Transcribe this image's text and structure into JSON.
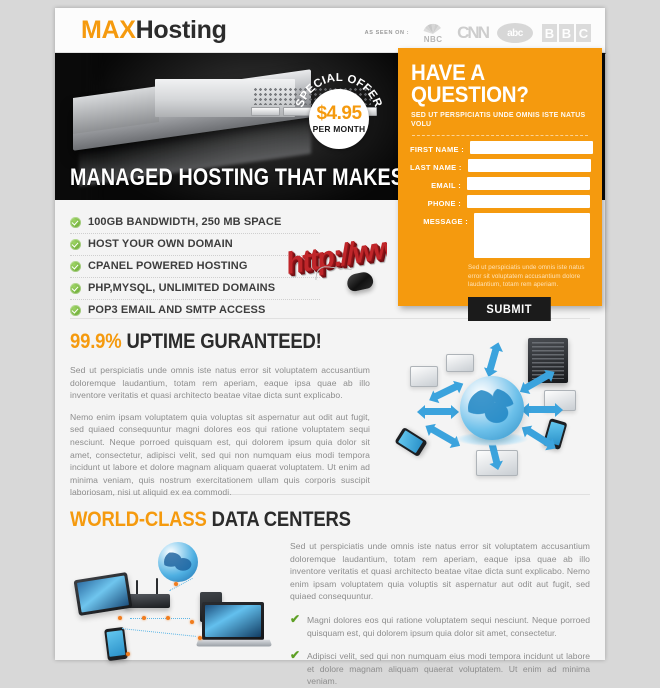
{
  "header": {
    "logo_primary": "MAX",
    "logo_secondary": "Hosting",
    "as_seen_label": "AS SEEN ON :",
    "brands": [
      "NBC",
      "CNN",
      "abc",
      "BBC"
    ],
    "nbc_label": "NBC",
    "cnn_label": "CNN",
    "abc_label": "abc",
    "bbc_letters": [
      "B",
      "B",
      "C"
    ]
  },
  "hero": {
    "headline": "MANAGED HOSTING THAT MAKES SENSE",
    "offer_ring": "SPECIAL OFFER",
    "offer_price": "$4.95",
    "offer_period": "PER MONTH",
    "server_image_alt": "rackmount-server"
  },
  "form": {
    "title": "HAVE A QUESTION?",
    "subtitle": "SED UT PERSPICIATIS UNDE OMNIS ISTE NATUS VOLU",
    "fields": [
      {
        "label": "FIRST NAME :",
        "value": "",
        "placeholder": ""
      },
      {
        "label": "LAST NAME :",
        "value": "",
        "placeholder": ""
      },
      {
        "label": "EMAIL :",
        "value": "",
        "placeholder": ""
      },
      {
        "label": "PHONE :",
        "value": "",
        "placeholder": ""
      },
      {
        "label": "MESSAGE :",
        "value": "",
        "placeholder": ""
      }
    ],
    "disclaimer": "Sed ut perspiciatis unde omnis iste natus error sit voluptatem accusantium dolore laudantium, totam rem aperiam.",
    "submit_label": "SUBMIT",
    "accent_color": "#f59a0e",
    "button_color": "#1b1b1b"
  },
  "features": [
    "100GB BANDWIDTH, 250 MB SPACE",
    "HOST YOUR OWN DOMAIN",
    "CPANEL POWERED HOSTING",
    "PHP,MYSQL, UNLIMITED DOMAINS",
    "POP3 EMAIL AND SMTP ACCESS"
  ],
  "http_graphic": {
    "text": "http://www",
    "color": "#c0262a"
  },
  "uptime": {
    "title_highlight": "99.9%",
    "title_rest": "UPTIME GURANTEED!",
    "paragraph1": "Sed ut perspiciatis unde omnis iste natus error sit voluptatem accusantium doloremque laudantium, totam rem aperiam, eaque ipsa quae ab illo inventore veritatis et quasi architecto beatae vitae dicta sunt explicabo.",
    "paragraph2": "Nemo enim ipsam voluptatem quia voluptas sit aspernatur aut odit aut fugit, sed quiaed consequuntur magni dolores eos qui ratione voluptatem sequi nesciunt. Neque porroed quisquam est, qui dolorem ipsum quia dolor sit amet, consectetur, adipisci velit, sed qui non numquam eius modi tempora incidunt ut labore et dolore magnam aliquam quaerat voluptatem. Ut enim ad minima veniam, quis nostrum exercitationem ullam quis  corporis suscipit laboriosam, nisi ut aliquid ex ea commodi.",
    "image_alt": "global-network-diagram"
  },
  "datacenters": {
    "title_highlight": "WORLD-CLASS",
    "title_rest": "DATA CENTERS",
    "paragraph": "Sed ut perspiciatis unde omnis iste natus error sit voluptatem accusantium doloremque laudantium, totam rem aperiam, eaque ipsa quae ab illo inventore veritatis et quasi architecto beatae vitae dicta sunt explicabo. Nemo enim ipsam voluptatem quia voluptis sit aspernatur aut odit aut fugit, sed quiaed consequuntur.",
    "bullets": [
      "Magni dolores eos qui ratione voluptatem sequi nesciunt. Neque porroed quisquam est, qui dolorem ipsum quia dolor sit amet, consectetur.",
      "Adipisci velit, sed qui non numquam eius modi tempora incidunt ut labore et dolore magnam aliquam quaerat voluptatem. Ut enim ad minima veniam."
    ],
    "image_alt": "devices-router-network"
  },
  "colors": {
    "accent": "#f59a0e",
    "dark": "#1b1b1b",
    "page_bg": "#d8d8d8",
    "sheet_bg": "#f4f4f4",
    "body_text": "#8d8d8d",
    "check_green": "#5ea025"
  }
}
